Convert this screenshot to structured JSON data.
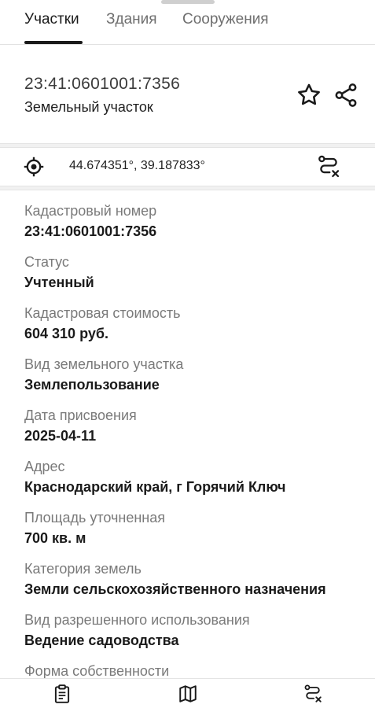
{
  "tabs": [
    {
      "label": "Участки",
      "active": true
    },
    {
      "label": "Здания",
      "active": false
    },
    {
      "label": "Сооружения",
      "active": false
    }
  ],
  "header": {
    "title": "23:41:0601001:7356",
    "subtitle": "Земельный участок",
    "actions": [
      "star-icon",
      "share-icon"
    ]
  },
  "coordinates": {
    "text": "44.674351°, 39.187833°",
    "left_icon": "crosshair-icon",
    "right_icon": "route-clear-icon"
  },
  "fields": [
    {
      "label": "Кадастровый номер",
      "value": "23:41:0601001:7356"
    },
    {
      "label": "Статус",
      "value": "Учтенный"
    },
    {
      "label": "Кадастровая стоимость",
      "value": "604 310 руб."
    },
    {
      "label": "Вид земельного участка",
      "value": "Землепользование"
    },
    {
      "label": "Дата присвоения",
      "value": "2025-04-11"
    },
    {
      "label": "Адрес",
      "value": "Краснодарский край, г Горячий Ключ"
    },
    {
      "label": "Площадь уточненная",
      "value": "700 кв. м"
    },
    {
      "label": "Категория земель",
      "value": "Земли сельскохозяйственного назначения"
    },
    {
      "label": "Вид разрешенного использования",
      "value": "Ведение садоводства"
    },
    {
      "label": "Форма собственности",
      "value": ""
    }
  ],
  "bottom_bar": {
    "items": [
      "clipboard-icon",
      "map-icon",
      "route-icon"
    ]
  },
  "colors": {
    "text_primary": "#1a1a1a",
    "text_secondary": "#7a7a7a",
    "divider": "#e4e4e4",
    "band": "#f1f1f1"
  }
}
